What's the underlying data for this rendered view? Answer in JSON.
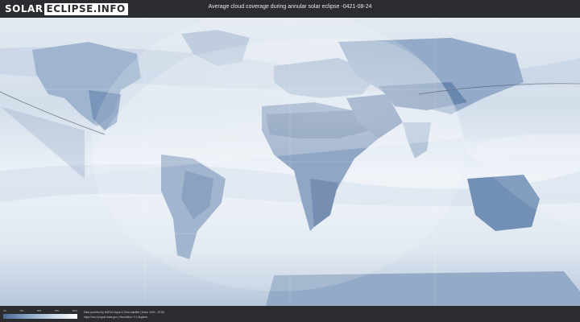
{
  "header": {
    "logo_part1": "SOLAR",
    "logo_part2": "ECLIPSE.INFO",
    "title": "Average cloud coverage during annular solar eclipse -0421-08-24"
  },
  "legend": {
    "ticks": [
      "0%",
      "25%",
      "50%",
      "75%",
      "100%"
    ],
    "colors": {
      "low": "#4a6a96",
      "mid": "#c7d7e8",
      "high": "#ffffff"
    }
  },
  "footer": {
    "credit_line1": "Data provided by NASA's Aqua & Terra satellite (Years: 2000 - 2019)",
    "credit_line2": "https://neo.sci.gsfc.nasa.gov | Resolution: 0.1 degrees"
  },
  "map": {
    "region_name": "world",
    "eclipse_path": "annular"
  }
}
